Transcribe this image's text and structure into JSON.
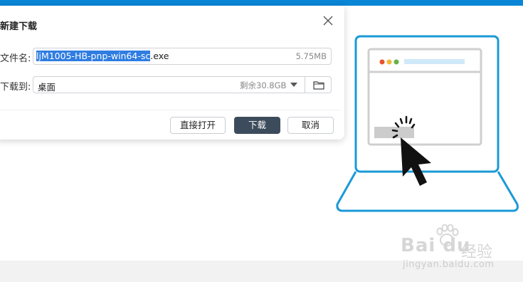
{
  "dialog": {
    "title": "新建下载",
    "filename_label": "文件名:",
    "filename_selected": "ljM1005-HB-pnp-win64-sc",
    "filename_rest": ".exe",
    "file_size": "5.75MB",
    "saveto_label": "下载到:",
    "save_path": "桌面",
    "free_space": "剩余30.8GB",
    "buttons": {
      "open_directly": "直接打开",
      "download": "下载",
      "cancel": "取消"
    }
  },
  "watermark": {
    "brand": "Bai du",
    "brand_zh": "经验",
    "url": "jingyan.baidu.com"
  },
  "colors": {
    "top_bar": "#0a86d6",
    "primary_button": "#3d4c5c",
    "selection": "#2f7de1",
    "laptop_outline": "#1a9ad6"
  },
  "icons": {
    "close": "close-icon",
    "dropdown": "chevron-down-icon",
    "folder": "folder-icon",
    "cursor": "mouse-pointer-icon"
  }
}
